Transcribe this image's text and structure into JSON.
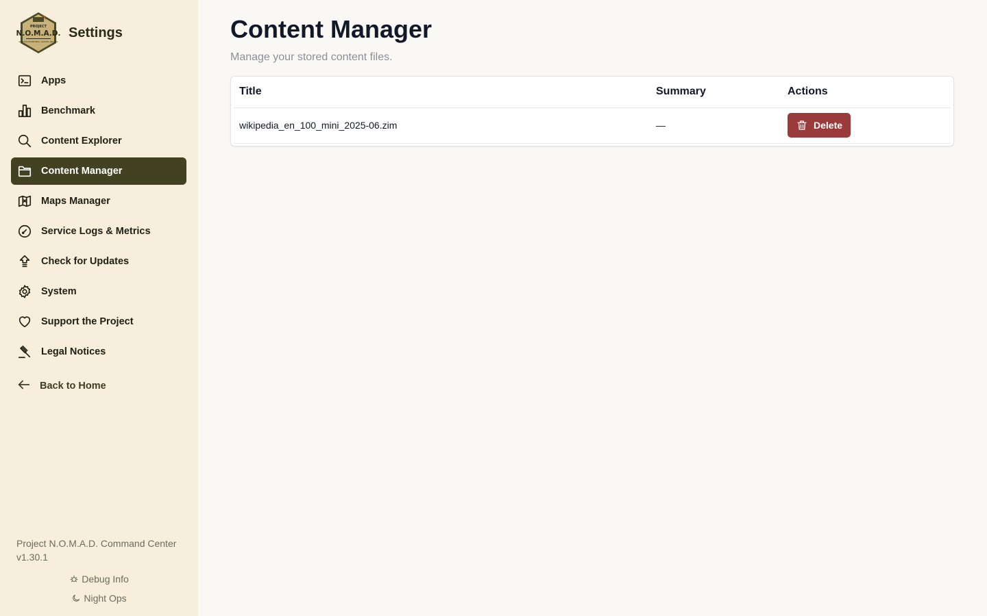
{
  "sidebar": {
    "title": "Settings",
    "logo": {
      "top_text": "PROJECT",
      "main_text": "N.O.M.A.D.",
      "bottom_text": "NODE FOR OFFLINE MEDIA, ARCHIVES, AND DATA"
    },
    "items": [
      {
        "label": "Apps",
        "icon": "terminal-icon",
        "active": false
      },
      {
        "label": "Benchmark",
        "icon": "bar-chart-icon",
        "active": false
      },
      {
        "label": "Content Explorer",
        "icon": "search-icon",
        "active": false
      },
      {
        "label": "Content Manager",
        "icon": "folder-icon",
        "active": true
      },
      {
        "label": "Maps Manager",
        "icon": "map-icon",
        "active": false
      },
      {
        "label": "Service Logs & Metrics",
        "icon": "gauge-icon",
        "active": false
      },
      {
        "label": "Check for Updates",
        "icon": "upload-arrow-icon",
        "active": false
      },
      {
        "label": "System",
        "icon": "gear-icon",
        "active": false
      },
      {
        "label": "Support the Project",
        "icon": "heart-icon",
        "active": false
      },
      {
        "label": "Legal Notices",
        "icon": "gavel-icon",
        "active": false
      }
    ],
    "back_label": "Back to Home",
    "footer": {
      "product": "Project N.O.M.A.D. Command Center",
      "version": "v1.30.1",
      "debug_label": "Debug Info",
      "night_label": "Night Ops"
    }
  },
  "main": {
    "title": "Content Manager",
    "subtitle": "Manage your stored content files.",
    "table": {
      "columns": [
        "Title",
        "Summary",
        "Actions"
      ],
      "rows": [
        {
          "title": "wikipedia_en_100_mini_2025-06.zim",
          "summary": "—",
          "action_label": "Delete"
        }
      ]
    }
  },
  "colors": {
    "sidebar_bg": "#f7eedb",
    "active_bg": "#424223",
    "delete_bg": "#9b3a3a",
    "page_bg": "#faf8f4"
  }
}
